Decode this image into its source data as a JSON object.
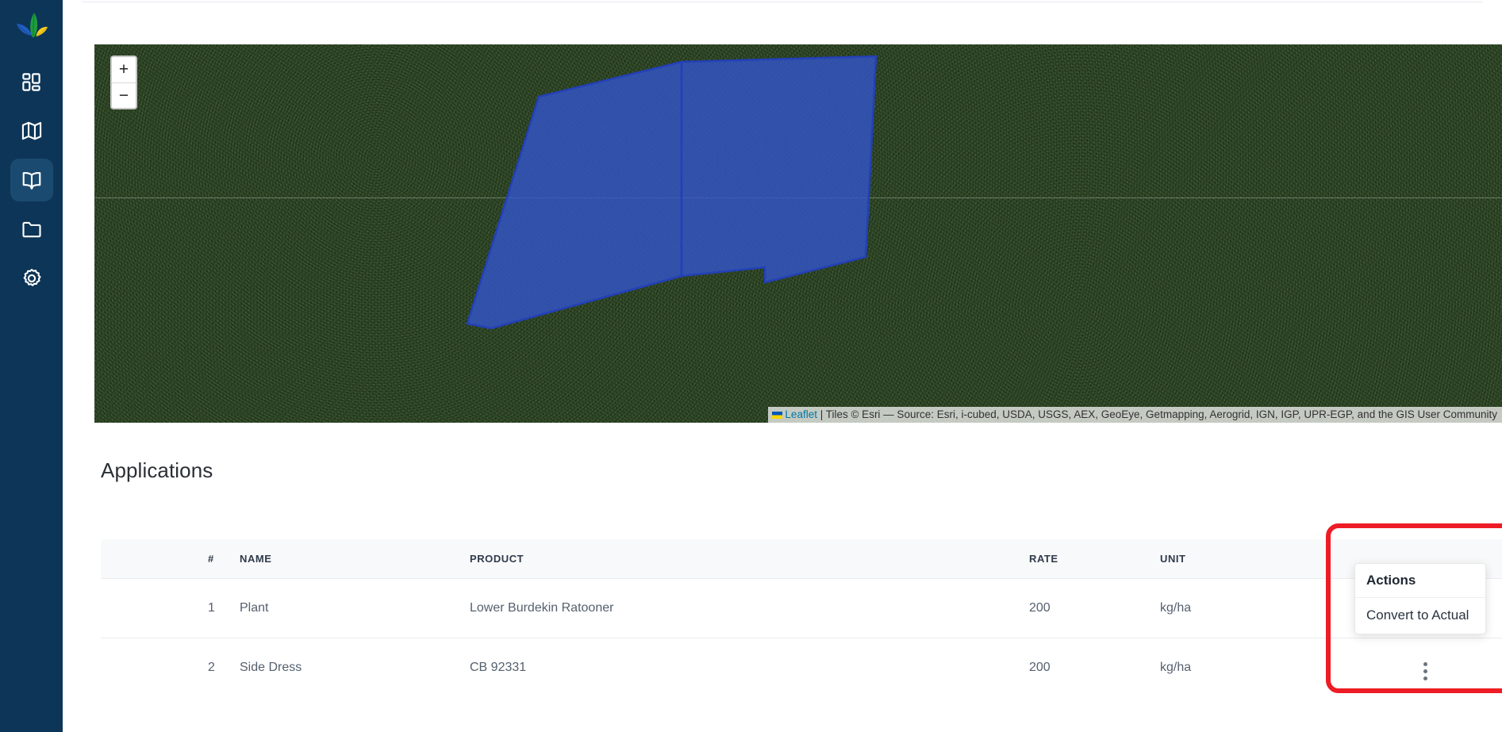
{
  "sidebar": {
    "logo": "leaf-logo",
    "items": [
      {
        "icon": "dashboard-grid-icon",
        "name": "dashboard",
        "active": false
      },
      {
        "icon": "map-icon",
        "name": "map",
        "active": false
      },
      {
        "icon": "book-icon",
        "name": "records",
        "active": true
      },
      {
        "icon": "folder-icon",
        "name": "files",
        "active": false
      },
      {
        "icon": "gear-icon",
        "name": "settings",
        "active": false
      }
    ],
    "bg_color": "#0d3557",
    "active_bg_color": "#1b4a70"
  },
  "map": {
    "zoom_in_label": "+",
    "zoom_out_label": "−",
    "attribution_leaflet": "Leaflet",
    "attribution_separator": " | ",
    "attribution_text": "Tiles © Esri — Source: Esri, i-cubed, USDA, USGS, AEX, GeoEye, Getmapping, Aerogrid, IGN, IGP, UPR-EGP, and the GIS User Community",
    "polygon_color": "#3355cc",
    "polygon_stroke_color": "#2340b8"
  },
  "main": {
    "section_title": "Applications",
    "table": {
      "columns": [
        "#",
        "NAME",
        "PRODUCT",
        "RATE",
        "UNIT"
      ],
      "rows": [
        {
          "num": "1",
          "name": "Plant",
          "product": "Lower Burdekin Ratooner",
          "rate": "200",
          "unit": "kg/ha"
        },
        {
          "num": "2",
          "name": "Side Dress",
          "product": "CB 92331",
          "rate": "200",
          "unit": "kg/ha"
        }
      ]
    }
  },
  "dropdown": {
    "header": "Actions",
    "items": [
      "Convert to Actual"
    ],
    "kebab_icon": "three-dots-vertical-icon"
  },
  "highlight": {
    "color": "#ee1c25"
  }
}
